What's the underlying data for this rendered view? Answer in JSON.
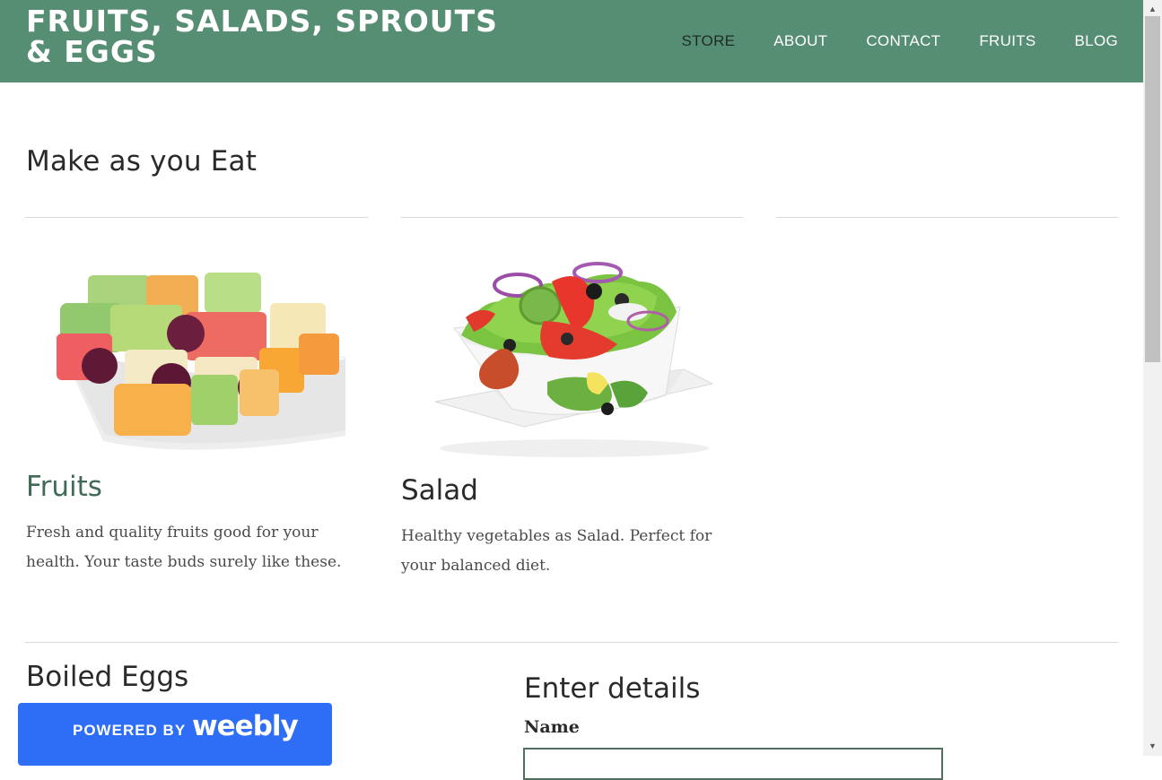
{
  "header": {
    "site_title": "FRUITS, SALADS, SPROUTS & EGGS",
    "nav": [
      "STORE",
      "ABOUT",
      "CONTACT",
      "FRUITS",
      "BLOG"
    ],
    "active_nav": "STORE",
    "background_color": "#568e74"
  },
  "main": {
    "section_title": "Make as you Eat",
    "cards": [
      {
        "title": "Fruits",
        "title_color": "#3f6b57",
        "text": "Fresh and quality fruits good for your health. Your taste buds surely like these.",
        "image": "fruit-salad-bowl-image"
      },
      {
        "title": "Salad",
        "title_color": "#2a2a2a",
        "text": "Healthy vegetables as Salad. Perfect for your balanced diet.",
        "image": "vegetable-salad-bowl-image"
      }
    ],
    "eggs_title": "Boiled Eggs",
    "form": {
      "title": "Enter details",
      "name_label": "Name",
      "name_value": ""
    }
  },
  "badge": {
    "powered_by": "POWERED BY",
    "brand": "weebly",
    "color": "#2e6df6"
  },
  "scrollbar": {
    "up_icon": "scroll-up-arrow-icon",
    "down_icon": "scroll-down-arrow-icon"
  }
}
